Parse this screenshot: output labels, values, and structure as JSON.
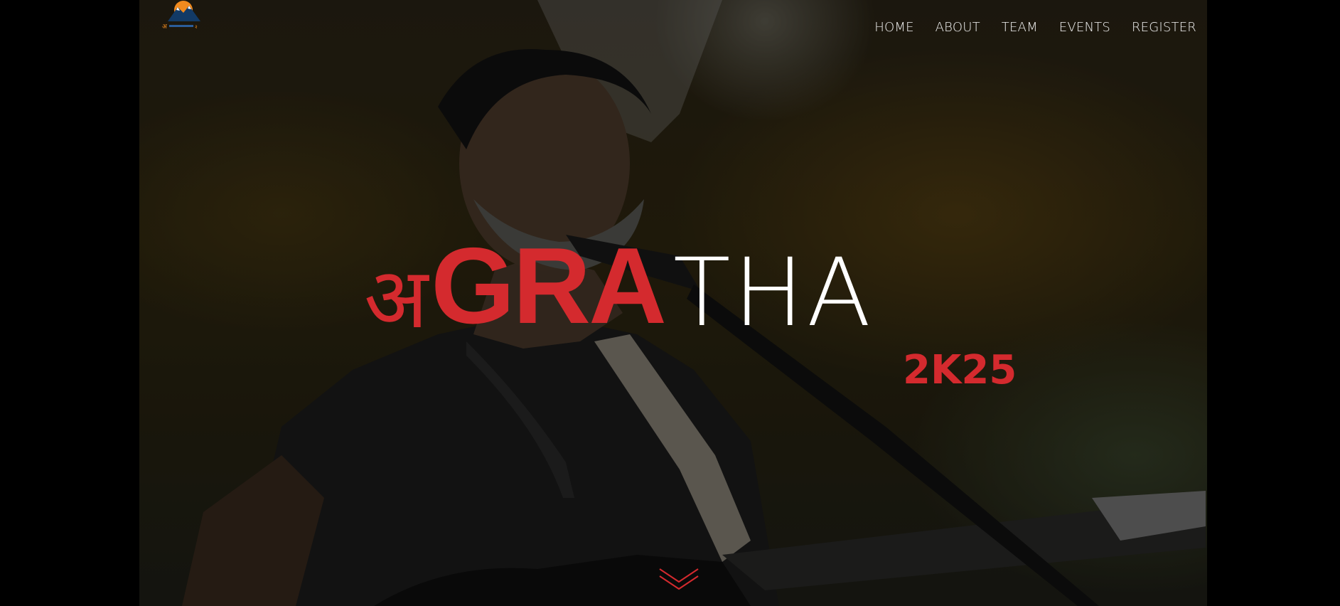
{
  "nav": {
    "items": [
      {
        "label": "HOME"
      },
      {
        "label": "ABOUT"
      },
      {
        "label": "TEAM"
      },
      {
        "label": "EVENTS"
      },
      {
        "label": "REGISTER"
      }
    ]
  },
  "hero": {
    "title_devanagari": "अ",
    "title_bold": "GRA",
    "title_light": "THA",
    "year": "2K25"
  },
  "colors": {
    "accent": "#d42a2e",
    "nav_text": "#f2f2f2",
    "background": "#000000"
  },
  "icons": {
    "logo": "mountain-sun-logo",
    "scroll": "chevron-down-icon"
  }
}
